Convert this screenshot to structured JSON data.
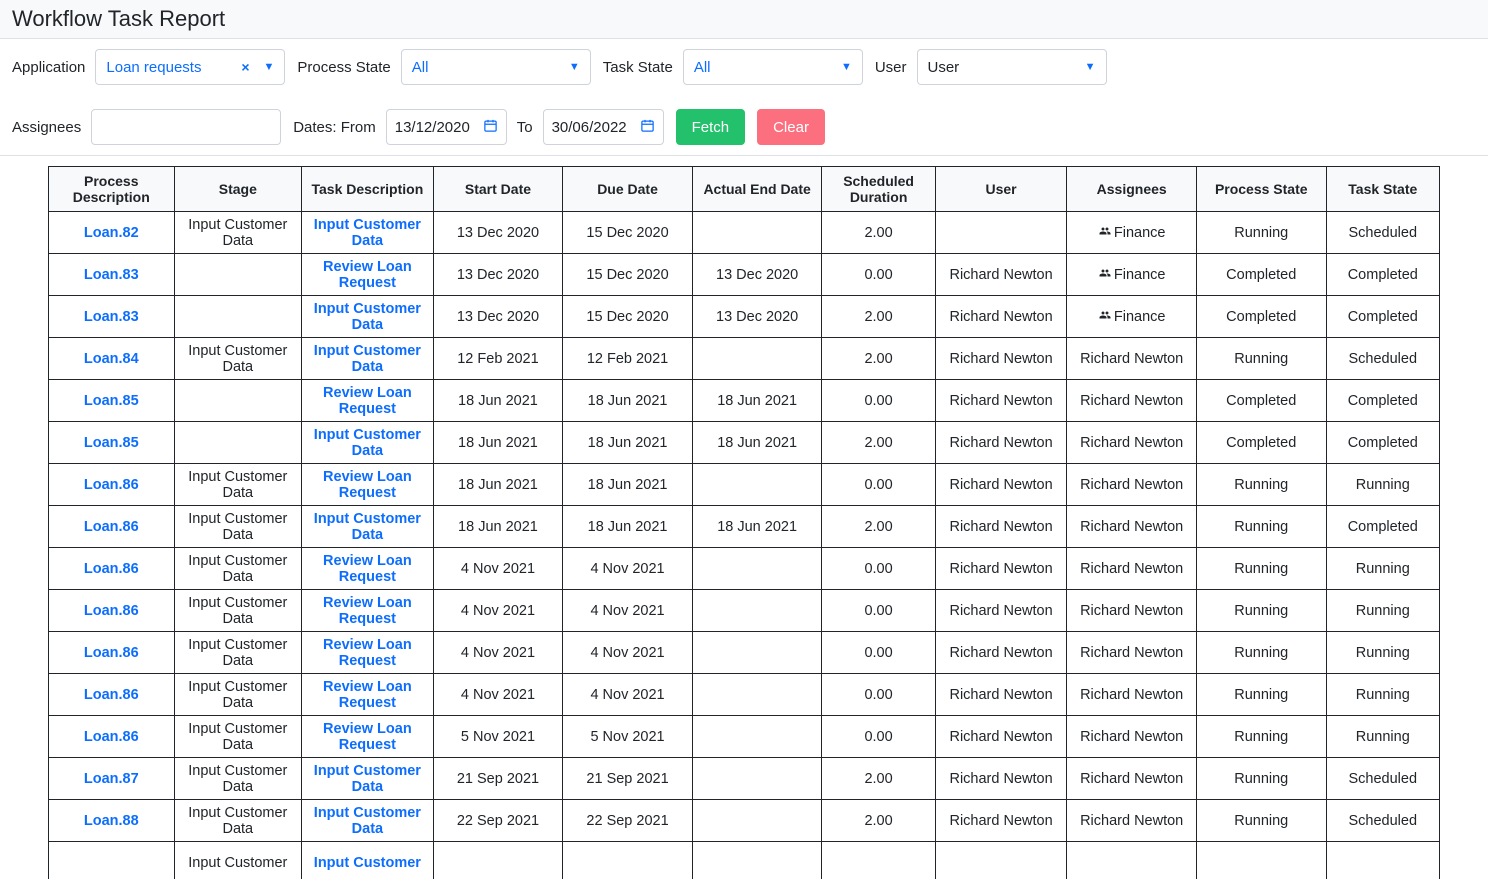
{
  "title": "Workflow Task Report",
  "filters": {
    "application": {
      "label": "Application",
      "value": "Loan requests"
    },
    "process_state": {
      "label": "Process State",
      "value": "All"
    },
    "task_state": {
      "label": "Task State",
      "value": "All"
    },
    "user": {
      "label": "User",
      "value": "User"
    },
    "assignees": {
      "label": "Assignees",
      "value": ""
    },
    "dates_label": "Dates: From",
    "date_from": "13/12/2020",
    "to_label": "To",
    "date_to": "30/06/2022",
    "fetch": "Fetch",
    "clear": "Clear"
  },
  "table": {
    "headers": [
      "Process Description",
      "Stage",
      "Task Description",
      "Start Date",
      "Due Date",
      "Actual End Date",
      "Scheduled Duration",
      "User",
      "Assignees",
      "Process State",
      "Task State"
    ],
    "rows": [
      {
        "process": "Loan.82",
        "stage": "Input Customer Data",
        "task": "Input Customer Data",
        "start": "13 Dec 2020",
        "due": "15 Dec 2020",
        "actual": "",
        "duration": "2.00",
        "user": "",
        "assignees": "Finance",
        "assignee_group": true,
        "ps": "Running",
        "ts": "Scheduled"
      },
      {
        "process": "Loan.83",
        "stage": "",
        "task": "Review Loan Request",
        "start": "13 Dec 2020",
        "due": "15 Dec 2020",
        "actual": "13 Dec 2020",
        "duration": "0.00",
        "user": "Richard Newton",
        "assignees": "Finance",
        "assignee_group": true,
        "ps": "Completed",
        "ts": "Completed"
      },
      {
        "process": "Loan.83",
        "stage": "",
        "task": "Input Customer Data",
        "start": "13 Dec 2020",
        "due": "15 Dec 2020",
        "actual": "13 Dec 2020",
        "duration": "2.00",
        "user": "Richard Newton",
        "assignees": "Finance",
        "assignee_group": true,
        "ps": "Completed",
        "ts": "Completed"
      },
      {
        "process": "Loan.84",
        "stage": "Input Customer Data",
        "task": "Input Customer Data",
        "start": "12 Feb 2021",
        "due": "12 Feb 2021",
        "actual": "",
        "duration": "2.00",
        "user": "Richard Newton",
        "assignees": "Richard Newton",
        "assignee_group": false,
        "ps": "Running",
        "ts": "Scheduled"
      },
      {
        "process": "Loan.85",
        "stage": "",
        "task": "Review Loan Request",
        "start": "18 Jun 2021",
        "due": "18 Jun 2021",
        "actual": "18 Jun 2021",
        "duration": "0.00",
        "user": "Richard Newton",
        "assignees": "Richard Newton",
        "assignee_group": false,
        "ps": "Completed",
        "ts": "Completed"
      },
      {
        "process": "Loan.85",
        "stage": "",
        "task": "Input Customer Data",
        "start": "18 Jun 2021",
        "due": "18 Jun 2021",
        "actual": "18 Jun 2021",
        "duration": "2.00",
        "user": "Richard Newton",
        "assignees": "Richard Newton",
        "assignee_group": false,
        "ps": "Completed",
        "ts": "Completed"
      },
      {
        "process": "Loan.86",
        "stage": "Input Customer Data",
        "task": "Review Loan Request",
        "start": "18 Jun 2021",
        "due": "18 Jun 2021",
        "actual": "",
        "duration": "0.00",
        "user": "Richard Newton",
        "assignees": "Richard Newton",
        "assignee_group": false,
        "ps": "Running",
        "ts": "Running"
      },
      {
        "process": "Loan.86",
        "stage": "Input Customer Data",
        "task": "Input Customer Data",
        "start": "18 Jun 2021",
        "due": "18 Jun 2021",
        "actual": "18 Jun 2021",
        "duration": "2.00",
        "user": "Richard Newton",
        "assignees": "Richard Newton",
        "assignee_group": false,
        "ps": "Running",
        "ts": "Completed"
      },
      {
        "process": "Loan.86",
        "stage": "Input Customer Data",
        "task": "Review Loan Request",
        "start": "4 Nov 2021",
        "due": "4 Nov 2021",
        "actual": "",
        "duration": "0.00",
        "user": "Richard Newton",
        "assignees": "Richard Newton",
        "assignee_group": false,
        "ps": "Running",
        "ts": "Running"
      },
      {
        "process": "Loan.86",
        "stage": "Input Customer Data",
        "task": "Review Loan Request",
        "start": "4 Nov 2021",
        "due": "4 Nov 2021",
        "actual": "",
        "duration": "0.00",
        "user": "Richard Newton",
        "assignees": "Richard Newton",
        "assignee_group": false,
        "ps": "Running",
        "ts": "Running"
      },
      {
        "process": "Loan.86",
        "stage": "Input Customer Data",
        "task": "Review Loan Request",
        "start": "4 Nov 2021",
        "due": "4 Nov 2021",
        "actual": "",
        "duration": "0.00",
        "user": "Richard Newton",
        "assignees": "Richard Newton",
        "assignee_group": false,
        "ps": "Running",
        "ts": "Running"
      },
      {
        "process": "Loan.86",
        "stage": "Input Customer Data",
        "task": "Review Loan Request",
        "start": "4 Nov 2021",
        "due": "4 Nov 2021",
        "actual": "",
        "duration": "0.00",
        "user": "Richard Newton",
        "assignees": "Richard Newton",
        "assignee_group": false,
        "ps": "Running",
        "ts": "Running"
      },
      {
        "process": "Loan.86",
        "stage": "Input Customer Data",
        "task": "Review Loan Request",
        "start": "5 Nov 2021",
        "due": "5 Nov 2021",
        "actual": "",
        "duration": "0.00",
        "user": "Richard Newton",
        "assignees": "Richard Newton",
        "assignee_group": false,
        "ps": "Running",
        "ts": "Running"
      },
      {
        "process": "Loan.87",
        "stage": "Input Customer Data",
        "task": "Input Customer Data",
        "start": "21 Sep 2021",
        "due": "21 Sep 2021",
        "actual": "",
        "duration": "2.00",
        "user": "Richard Newton",
        "assignees": "Richard Newton",
        "assignee_group": false,
        "ps": "Running",
        "ts": "Scheduled"
      },
      {
        "process": "Loan.88",
        "stage": "Input Customer Data",
        "task": "Input Customer Data",
        "start": "22 Sep 2021",
        "due": "22 Sep 2021",
        "actual": "",
        "duration": "2.00",
        "user": "Richard Newton",
        "assignees": "Richard Newton",
        "assignee_group": false,
        "ps": "Running",
        "ts": "Scheduled"
      },
      {
        "process": "",
        "stage": "Input Customer",
        "task": "Input Customer",
        "start": "",
        "due": "",
        "actual": "",
        "duration": "",
        "user": "",
        "assignees": "",
        "assignee_group": false,
        "ps": "",
        "ts": ""
      }
    ]
  }
}
